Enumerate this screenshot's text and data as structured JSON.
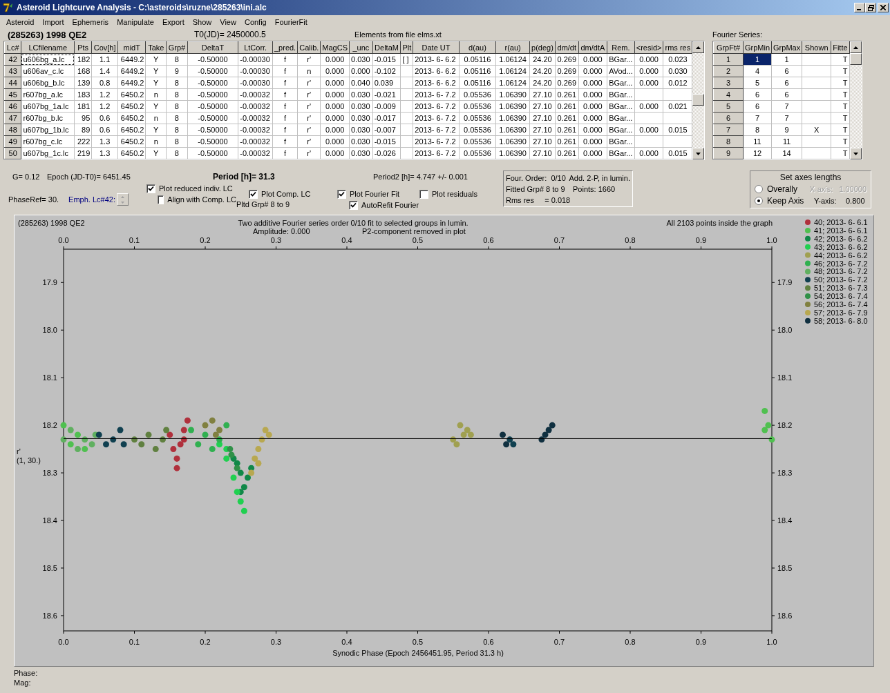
{
  "window": {
    "title": "Asteroid Lightcurve Analysis - C:\\asteroids\\ruzne\\285263\\ini.alc"
  },
  "menu": [
    "Asteroid",
    "Import",
    "Ephemeris",
    "Manipulate",
    "Export",
    "Show",
    "View",
    "Config",
    "FourierFit"
  ],
  "header": {
    "object": "(285263) 1998 QE2",
    "t0": "T0(JD)= 2450000.5",
    "elements": "Elements from file elms.xt"
  },
  "lc_table": {
    "columns": [
      "Lc#",
      "LCfilename",
      "Pts",
      "Cov[h]",
      "midT",
      "Take",
      "Grp#",
      "DeltaT",
      "LtCorr.",
      "_pred.",
      "Calib.",
      "MagCS",
      "_unc",
      "DeltaM",
      "Plt",
      "Date UT",
      "d(au)",
      "r(au)",
      "p(deg)",
      "dm/dt",
      "dm/dtA",
      "Rem.",
      "<resid>",
      "rms res"
    ],
    "rows": [
      {
        "focused": true,
        "cells": [
          "42",
          "u606bg_a.lc",
          "182",
          "1.1",
          "6449.2",
          "Y",
          "8",
          "-0.50000",
          "-0.00030",
          "f",
          "r'",
          "0.000",
          "0.030",
          "-0.015",
          "[ ]",
          "2013- 6- 6.2",
          "0.05116",
          "1.06124",
          "24.20",
          "0.269",
          "0.000",
          "BGar...",
          "0.000",
          "0.023"
        ]
      },
      {
        "focused": false,
        "cells": [
          "43",
          "u606av_c.lc",
          "168",
          "1.4",
          "6449.2",
          "Y",
          "9",
          "-0.50000",
          "-0.00030",
          "f",
          "n",
          "0.000",
          "0.000",
          "-0.102",
          null,
          "2013- 6- 6.2",
          "0.05116",
          "1.06124",
          "24.20",
          "0.269",
          "0.000",
          "AVod...",
          "0.000",
          "0.030"
        ]
      },
      {
        "focused": false,
        "cells": [
          "44",
          "u606bg_b.lc",
          "139",
          "0.8",
          "6449.2",
          "Y",
          "8",
          "-0.50000",
          "-0.00030",
          "f",
          "r'",
          "0.000",
          "0.040",
          " 0.039",
          null,
          "2013- 6- 6.2",
          "0.05116",
          "1.06124",
          "24.20",
          "0.269",
          "0.000",
          "BGar...",
          "0.000",
          "0.012"
        ]
      },
      {
        "focused": false,
        "cells": [
          "45",
          "r607bg_a.lc",
          "183",
          "1.2",
          "6450.2",
          "n",
          "8",
          "-0.50000",
          "-0.00032",
          "f",
          "r'",
          "0.000",
          "0.030",
          "-0.021",
          null,
          "2013- 6- 7.2",
          "0.05536",
          "1.06390",
          "27.10",
          "0.261",
          "0.000",
          "BGar...",
          null,
          null
        ]
      },
      {
        "focused": false,
        "cells": [
          "46",
          "u607bg_1a.lc",
          "181",
          "1.2",
          "6450.2",
          "Y",
          "8",
          "-0.50000",
          "-0.00032",
          "f",
          "r'",
          "0.000",
          "0.030",
          "-0.009",
          null,
          "2013- 6- 7.2",
          "0.05536",
          "1.06390",
          "27.10",
          "0.261",
          "0.000",
          "BGar...",
          "0.000",
          "0.021"
        ]
      },
      {
        "focused": false,
        "cells": [
          "47",
          "r607bg_b.lc",
          "95",
          "0.6",
          "6450.2",
          "n",
          "8",
          "-0.50000",
          "-0.00032",
          "f",
          "r'",
          "0.000",
          "0.030",
          "-0.017",
          null,
          "2013- 6- 7.2",
          "0.05536",
          "1.06390",
          "27.10",
          "0.261",
          "0.000",
          "BGar...",
          null,
          null
        ]
      },
      {
        "focused": false,
        "cells": [
          "48",
          "u607bg_1b.lc",
          "89",
          "0.6",
          "6450.2",
          "Y",
          "8",
          "-0.50000",
          "-0.00032",
          "f",
          "r'",
          "0.000",
          "0.030",
          "-0.007",
          null,
          "2013- 6- 7.2",
          "0.05536",
          "1.06390",
          "27.10",
          "0.261",
          "0.000",
          "BGar...",
          "0.000",
          "0.015"
        ]
      },
      {
        "focused": false,
        "cells": [
          "49",
          "r607bg_c.lc",
          "222",
          "1.3",
          "6450.2",
          "n",
          "8",
          "-0.50000",
          "-0.00032",
          "f",
          "r'",
          "0.000",
          "0.030",
          "-0.015",
          null,
          "2013- 6- 7.2",
          "0.05536",
          "1.06390",
          "27.10",
          "0.261",
          "0.000",
          "BGar...",
          null,
          null
        ]
      },
      {
        "focused": false,
        "cells": [
          "50",
          "u607bg_1c.lc",
          "219",
          "1.3",
          "6450.2",
          "Y",
          "8",
          "-0.50000",
          "-0.00032",
          "f",
          "r'",
          "0.000",
          "0.030",
          "-0.026",
          null,
          "2013- 6- 7.2",
          "0.05536",
          "1.06390",
          "27.10",
          "0.261",
          "0.000",
          "BGar...",
          "0.000",
          "0.015"
        ]
      }
    ]
  },
  "fourier": {
    "label": "Fourier Series:",
    "columns": [
      "GrpFt#",
      "GrpMin",
      "GrpMax",
      "Shown",
      "Fitte"
    ],
    "rows": [
      {
        "num": "1",
        "min": "1",
        "max": "1",
        "fitted": "T",
        "selected": true
      },
      {
        "num": "2",
        "min": "4",
        "max": "6",
        "fitted": "T",
        "selected": false
      },
      {
        "num": "3",
        "min": "5",
        "max": "6",
        "fitted": "T",
        "selected": false
      },
      {
        "num": "4",
        "min": "6",
        "max": "6",
        "fitted": "T",
        "selected": false
      },
      {
        "num": "5",
        "min": "6",
        "max": "7",
        "fitted": "T",
        "selected": false
      },
      {
        "num": "6",
        "min": "7",
        "max": "7",
        "fitted": "T",
        "selected": false
      },
      {
        "num": "7",
        "min": "8",
        "max": "9",
        "shown": "X",
        "fitted": "T",
        "selected": false
      },
      {
        "num": "8",
        "min": "11",
        "max": "11",
        "fitted": "T",
        "selected": false
      },
      {
        "num": "9",
        "min": "12",
        "max": "14",
        "fitted": "T",
        "selected": false
      }
    ]
  },
  "params": {
    "g": "G= 0.12",
    "epoch": "Epoch (JD-T0)= 6451.45",
    "period": "Period [h]= 31.3",
    "period2": "Period2 [h]= 4.747 +/- 0.001",
    "phase_ref": "PhaseRef= 30.",
    "emph": "Emph. Lc#42:",
    "pltd_grp": "Pltd Grp#  8  to  9"
  },
  "checkboxes": [
    {
      "label": "Plot reduced indiv. LC",
      "checked": true
    },
    {
      "label": "Align with Comp. LC",
      "checked": false
    },
    {
      "label": "Plot Comp. LC",
      "checked": true
    },
    {
      "label": "Plot Fourier Fit",
      "checked": true
    },
    {
      "label": "Plot residuals",
      "checked": false
    },
    {
      "label": "AutoRefit Fourier",
      "checked": true
    }
  ],
  "fit_info": {
    "lines": [
      [
        "Four. Order:  0/10",
        "Add. 2-P, in lumin."
      ],
      [
        "Fitted Grp# 8 to 9",
        "Points: 1660"
      ],
      [
        "Rms res     = 0.018"
      ]
    ]
  },
  "axes": {
    "title": "Set axes lengths",
    "options": [
      {
        "label": "Overally",
        "selected": false
      },
      {
        "label": "Keep Axis",
        "selected": true
      }
    ],
    "fields": [
      {
        "label": "X-axis:",
        "value": "1.00000",
        "disabled": true
      },
      {
        "label": "Y-axis:",
        "value": "0.800",
        "disabled": false
      }
    ]
  },
  "chart": {
    "object": "(285263) 1998 QE2",
    "subtitle": "Two additive Fourier series order 0/10 fit to selected groups in lumin.",
    "amplitude": "Amplitude: 0.000",
    "p2_note": "P2-component removed in plot",
    "points_note": "All 2103 points inside the graph",
    "ylabel2": "(1, 30.)",
    "chart_data": {
      "type": "scatter",
      "xlabel": "Synodic Phase (Epoch 2456451.95, Period 31.3 h)",
      "ylabel": "r'",
      "xlim": [
        0,
        1
      ],
      "ylim": [
        18.632,
        17.83
      ],
      "xticks": [
        {
          "value": 0,
          "label": "0.0"
        },
        {
          "value": 0.1,
          "label": "0.1"
        },
        {
          "value": 0.2,
          "label": "0.2"
        },
        {
          "value": 0.3,
          "label": "0.3"
        },
        {
          "value": 0.4,
          "label": "0.4"
        },
        {
          "value": 0.5,
          "label": "0.5"
        },
        {
          "value": 0.6,
          "label": "0.6"
        },
        {
          "value": 0.7,
          "label": "0.7"
        },
        {
          "value": 0.8,
          "label": "0.8"
        },
        {
          "value": 0.9,
          "label": "0.9"
        },
        {
          "value": 1,
          "label": "1.0"
        }
      ],
      "yticks": [
        {
          "value": 17.9,
          "label": "17.9"
        },
        {
          "value": 18,
          "label": "18.0"
        },
        {
          "value": 18.1,
          "label": "18.1"
        },
        {
          "value": 18.2,
          "label": "18.2"
        },
        {
          "value": 18.3,
          "label": "18.3"
        },
        {
          "value": 18.4,
          "label": "18.4"
        },
        {
          "value": 18.5,
          "label": "18.5"
        },
        {
          "value": 18.6,
          "label": "18.6"
        }
      ],
      "series": [
        {
          "name": "40; 2013- 6- 6.1",
          "color": "#b0303c",
          "x": [
            0.15,
            0.16,
            0.165,
            0.17,
            0.175,
            0.155,
            0.16,
            0.17
          ],
          "values": [
            18.22,
            18.27,
            18.24,
            18.21,
            18.19,
            18.25,
            18.29,
            18.23
          ]
        },
        {
          "name": "41; 2013- 6- 6.1",
          "color": "#50c050",
          "x": [
            0.0,
            0.01,
            0.02,
            0.03,
            0.99,
            0.995,
            1.0,
            0.99
          ],
          "values": [
            18.2,
            18.24,
            18.22,
            18.25,
            18.17,
            18.2,
            18.23,
            18.21
          ]
        },
        {
          "name": "42; 2013- 6- 6.2",
          "color": "#108848",
          "x": [
            0.24,
            0.25,
            0.255,
            0.26,
            0.265,
            0.25,
            0.245
          ],
          "values": [
            18.27,
            18.3,
            18.33,
            18.31,
            18.29,
            18.34,
            18.28
          ]
        },
        {
          "name": "43; 2013- 6- 6.2",
          "color": "#20d050",
          "x": [
            0.22,
            0.23,
            0.24,
            0.25,
            0.255,
            0.245,
            0.23
          ],
          "values": [
            18.24,
            18.27,
            18.31,
            18.36,
            18.38,
            18.34,
            18.25
          ]
        },
        {
          "name": "44; 2013- 6- 6.2",
          "color": "#a0a050",
          "x": [
            0.55,
            0.555,
            0.565,
            0.57,
            0.575,
            0.56
          ],
          "values": [
            18.23,
            18.24,
            18.22,
            18.21,
            18.22,
            18.2
          ]
        },
        {
          "name": "46; 2013- 6- 7.2",
          "color": "#30b050",
          "x": [
            0.18,
            0.19,
            0.2,
            0.21,
            0.22,
            0.23
          ],
          "values": [
            18.21,
            18.24,
            18.22,
            18.25,
            18.23,
            18.2
          ]
        },
        {
          "name": "48; 2013- 6- 7.2",
          "color": "#60b060",
          "x": [
            0.0,
            0.01,
            0.02,
            0.03,
            0.04,
            0.045
          ],
          "values": [
            18.23,
            18.21,
            18.25,
            18.23,
            18.24,
            18.22
          ]
        },
        {
          "name": "50; 2013- 6- 7.2",
          "color": "#104050",
          "x": [
            0.05,
            0.06,
            0.07,
            0.08,
            0.085,
            0.63,
            0.635
          ],
          "values": [
            18.22,
            18.24,
            18.23,
            18.21,
            18.24,
            18.23,
            18.24
          ]
        },
        {
          "name": "51; 2013- 6- 7.3",
          "color": "#608040",
          "x": [
            0.1,
            0.11,
            0.12,
            0.13,
            0.14,
            0.145
          ],
          "values": [
            18.23,
            18.24,
            18.22,
            18.25,
            18.23,
            18.21
          ]
        },
        {
          "name": "54; 2013- 6- 7.4",
          "color": "#309048",
          "x": [
            0.235,
            0.237,
            0.245
          ],
          "values": [
            18.25,
            18.262,
            18.29
          ]
        },
        {
          "name": "56; 2013- 6- 7.4",
          "color": "#808040",
          "x": [
            0.2,
            0.21,
            0.22,
            0.215
          ],
          "values": [
            18.2,
            18.19,
            18.21,
            18.22
          ]
        },
        {
          "name": "57; 2013- 6- 7.9",
          "color": "#b8a850",
          "x": [
            0.265,
            0.27,
            0.275,
            0.28,
            0.285,
            0.29,
            0.275
          ],
          "values": [
            18.3,
            18.27,
            18.25,
            18.23,
            18.21,
            18.22,
            18.28
          ]
        },
        {
          "name": "58; 2013- 6- 8.0",
          "color": "#103040",
          "x": [
            0.62,
            0.625,
            0.68,
            0.685,
            0.69,
            0.675
          ],
          "values": [
            18.22,
            18.24,
            18.22,
            18.21,
            18.2,
            18.23
          ]
        }
      ],
      "ref_lines": [
        {
          "axis": "y",
          "value": 18.228
        }
      ],
      "legend": "right"
    }
  },
  "status": [
    "Phase:",
    "Mag:"
  ]
}
